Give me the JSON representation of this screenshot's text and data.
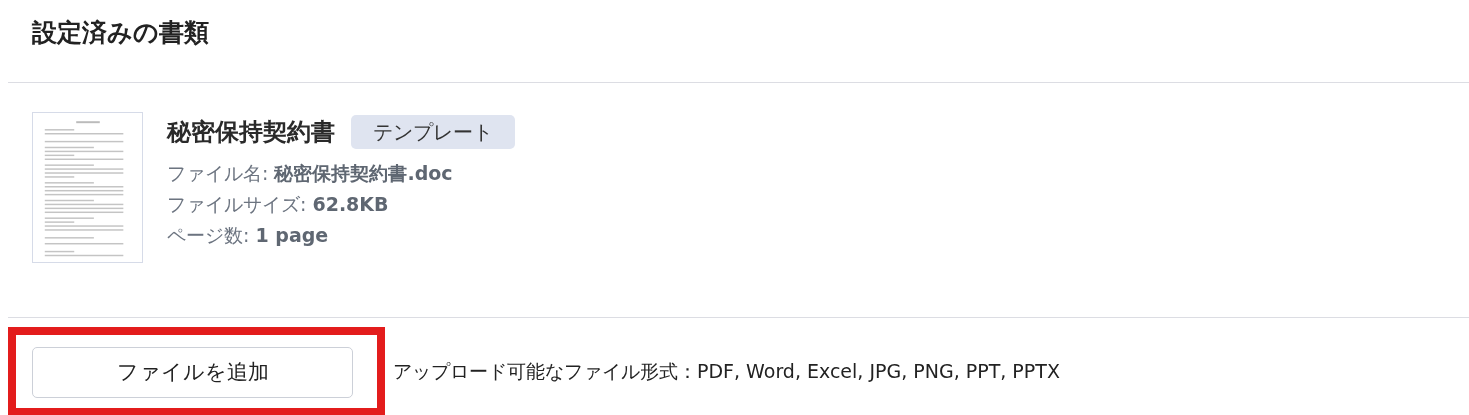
{
  "section_title": "設定済みの書類",
  "document": {
    "title": "秘密保持契約書",
    "tag": "テンプレート",
    "details": [
      "ファイル名: **秘密保持契約書.doc**",
      "ファイルサイズ: **62.8KB**",
      "ページ数: **1 page**"
    ]
  },
  "add_button": {
    "label": "ファイルを追加",
    "highlighted": true
  },
  "formats_note": "アップロード可能なファイル形式：PDF, Word, Excel, JPG, PNG, PPT, PPTX"
}
